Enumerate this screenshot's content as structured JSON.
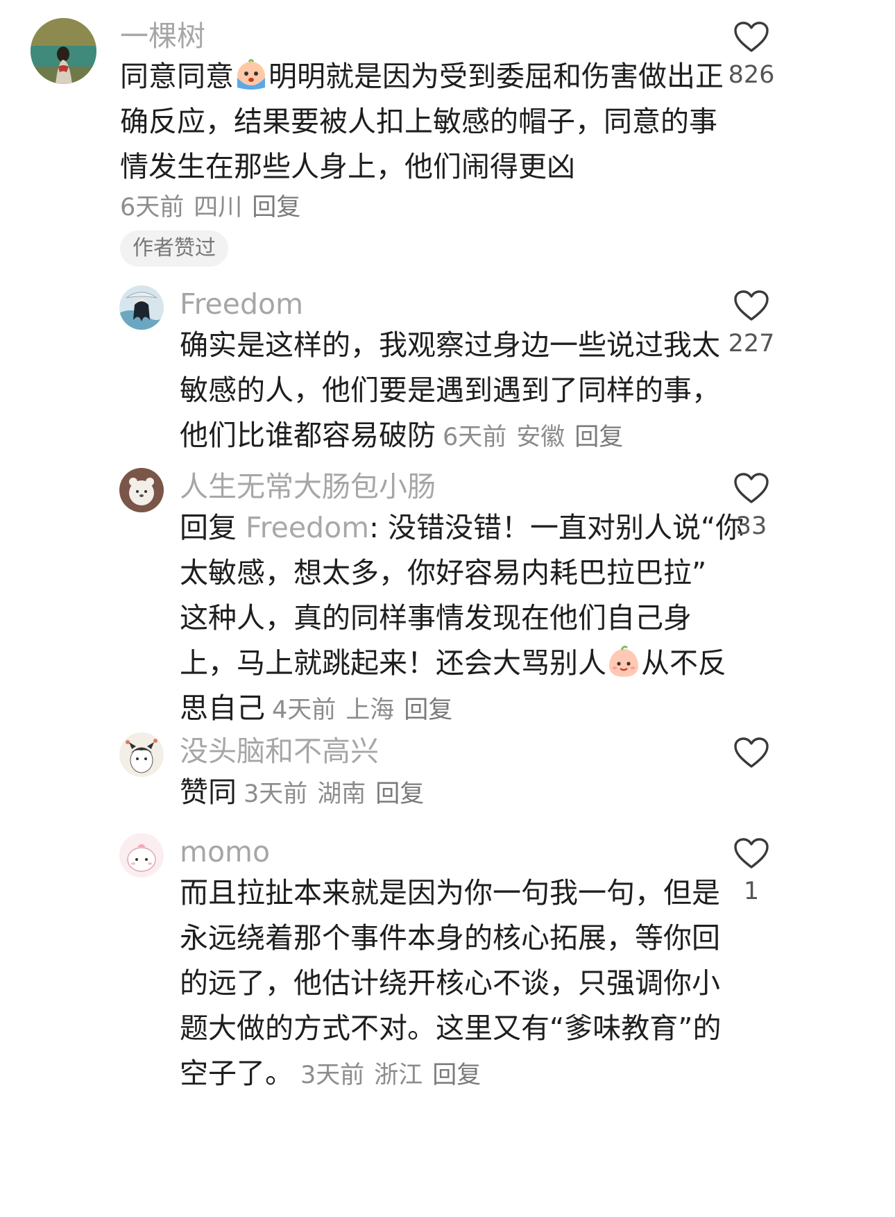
{
  "comments": [
    {
      "username": "一棵树",
      "lines": [
        {
          "pre": "同意同意",
          "emoji": "crying-face-emoji",
          "post": "明明就是因为受到委屈和伤害做出正"
        },
        "确反应，结果要被人扣上敏感的帽子，同意的事",
        "情发生在那些人身上，他们闹得更凶"
      ],
      "time": "6天前",
      "location": "四川",
      "reply_label": "回复",
      "badge": "作者赞过",
      "likes": "826"
    },
    {
      "username": "Freedom",
      "lines": [
        "确实是这样的，我观察过身边一些说过我太",
        "敏感的人，他们要是遇到遇到了同样的事，",
        "他们比谁都容易破防"
      ],
      "time": "6天前",
      "location": "安徽",
      "reply_label": "回复",
      "likes": "227"
    },
    {
      "username": "人生无常大肠包小肠",
      "reply_prefix": "回复",
      "reply_to": "Freedom",
      "lines": [
        "没错没错！一直对别人说“你",
        "太敏感，想太多，你好容易内耗巴拉巴拉”",
        "这种人，真的同样事情发现在他们自己身",
        {
          "pre": "上，马上就跳起来！还会大骂别人",
          "emoji": "smiling-peach-emoji",
          "post": "从不反"
        },
        "思自己"
      ],
      "time": "4天前",
      "location": "上海",
      "reply_label": "回复",
      "likes": "33"
    },
    {
      "username": "没头脑和不高兴",
      "lines": [
        "赞同"
      ],
      "time": "3天前",
      "location": "湖南",
      "reply_label": "回复",
      "likes": ""
    },
    {
      "username": "momo",
      "lines": [
        "而且拉扯本来就是因为你一句我一句，但是",
        "永远绕着那个事件本身的核心拓展，等你回",
        "的远了，他估计绕开核心不谈，只强调你小",
        "题大做的方式不对。这里又有“爹味教育”的",
        "空子了。"
      ],
      "time": "3天前",
      "location": "浙江",
      "reply_label": "回复",
      "likes": "1"
    }
  ],
  "icons": {
    "like": "heart-outline-icon",
    "avatar": "user-avatar"
  },
  "colors": {
    "username": "#a6a6a6",
    "meta": "#8c8c8c",
    "text": "#1e1e1e",
    "badge_bg": "#f2f2f2"
  }
}
